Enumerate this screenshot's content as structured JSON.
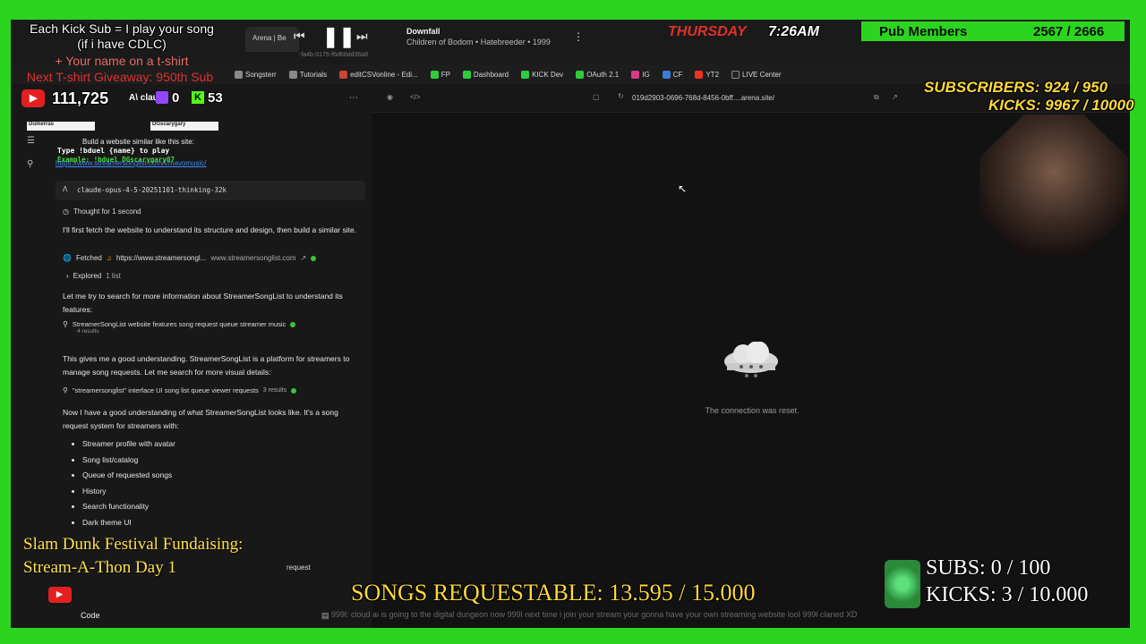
{
  "overlay": {
    "kick_sub_line": "Each Kick Sub = I play your song",
    "kick_sub_line2": "(if i have CDLC)",
    "tshirt_line": "+ Your name on a t-shirt",
    "giveaway_line": "Next T-shirt Giveaway: 950th Sub",
    "yt_count": "111,725",
    "channel_short": "A\\ claude",
    "twitch_count": "0",
    "kick_count": "53",
    "duel_name1": "Dumerras",
    "duel_name2": "DGscarygary",
    "duel_type_cmd": "Type !bduel {name} to play",
    "duel_example": "Example: !bduel DGscarygary07",
    "slam_dunk_line1": "Slam Dunk Festival Fundaising:",
    "slam_dunk_line2": "Stream-A-Thon Day 1",
    "songs_requestable": "SONGS REQUESTABLE: 13.595 / 15.000",
    "subs_goal": "SUBS: 0 / 100",
    "kicks_goal": "KICKS: 3 / 10.000",
    "thursday_label": "THURSDAY",
    "time_label": "7:26AM",
    "pub_members_label": "Pub Members",
    "pub_members_count": "2567 / 2666",
    "subscribers_label": "SUBSCRIBERS: 924 / 950",
    "kicks_top_label": "KICKS: 9967 / 10000",
    "now_playing_title": "Downfall",
    "now_playing_artist": "Children of Bodom • Hatebreeder • 1999",
    "ticker_text": "999l: cloud ai is going to the digital dungeon now 999l next time i join your stream your gonna have your own streaming website lool 999l claned XD"
  },
  "browser": {
    "tab_label": "Arena | Be",
    "tab_url_fragment": "-fa4b-0176-f6d68dd36a8",
    "bookmarks": [
      "Songsterr",
      "Tutorials",
      "editCSVonline - Edi...",
      "FP",
      "Dashboard",
      "KICK Dev",
      "OAuth 2.1",
      "IG",
      "CF",
      "YT2",
      "LIVE Center"
    ],
    "address": "019d2903-0696-768d-8456-0bff....arena.site/"
  },
  "chat": {
    "user_prompt": "Build a website similar like this site:",
    "user_link": "https://www.streamersonglist.com/t/mavomusic/",
    "model_name": "claude-opus-4-5-20251101-thinking-32k",
    "thought": "Thought for 1 second",
    "p1": "I'll first fetch the website to understand its structure and design, then build a similar site.",
    "fetched_label": "Fetched",
    "fetched_url": "https://www.streamersongl...",
    "fetched_domain": "www.streamersonglist.com",
    "explored_label": "Explored",
    "explored_count": "1 list",
    "p2": "Let me try to search for more information about StreamerSongList to understand its features:",
    "search1": "StreamerSongList website features song request queue streamer music",
    "search1_results": "4 results",
    "p3": "This gives me a good understanding. StreamerSongList is a platform for streamers to manage song requests. Let me search for more visual details:",
    "search2": "\"streamersonglist\" interface UI song list queue viewer requests",
    "search2_results": "3 results",
    "p4": "Now I have a good understanding of what StreamerSongList looks like. It's a song request system for streamers with:",
    "features": [
      "Streamer profile with avatar",
      "Song list/catalog",
      "Queue of requested songs",
      "History",
      "Search functionality",
      "Dark theme UI"
    ],
    "trailing": "request",
    "code_label": "Code"
  },
  "main": {
    "error_text": "The connection was reset."
  },
  "colors": {
    "green_screen": "#2bd41f",
    "accent_yellow": "#ffd93a",
    "thursday_red": "#e0302a"
  }
}
